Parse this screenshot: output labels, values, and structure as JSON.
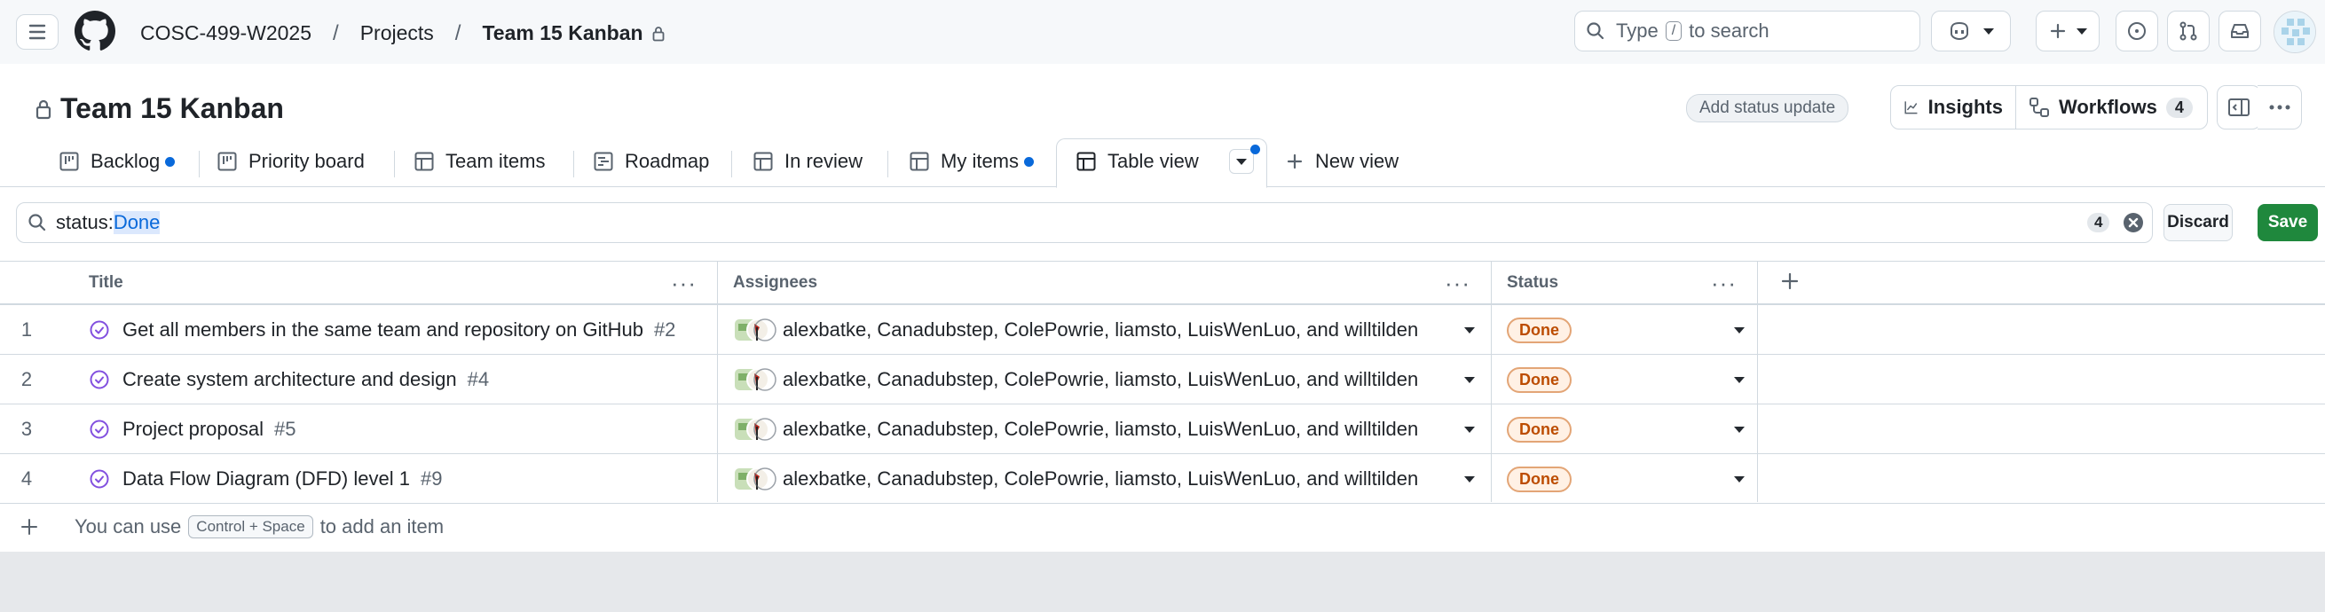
{
  "header": {
    "breadcrumb": [
      "COSC-499-W2025",
      "Projects",
      "Team 15 Kanban"
    ],
    "search_prefix": "Type",
    "search_kbd": "/",
    "search_suffix": "to search"
  },
  "project": {
    "title": "Team 15 Kanban",
    "add_status_update": "Add status update",
    "insights": "Insights",
    "workflows": "Workflows",
    "workflows_count": "4"
  },
  "tabs": [
    {
      "label": "Backlog",
      "dot": true
    },
    {
      "label": "Priority board",
      "dot": false
    },
    {
      "label": "Team items",
      "dot": false
    },
    {
      "label": "Roadmap",
      "dot": false
    },
    {
      "label": "In review",
      "dot": false
    },
    {
      "label": "My items",
      "dot": true
    },
    {
      "label": "Table view",
      "dot": true,
      "active": true
    }
  ],
  "new_view": "New view",
  "filter": {
    "key": "status:",
    "value": "Done",
    "count": "4",
    "discard": "Discard",
    "save": "Save"
  },
  "columns": {
    "title": "Title",
    "assignees": "Assignees",
    "status": "Status"
  },
  "rows": [
    {
      "num": "1",
      "title": "Get all members in the same team and repository on GitHub",
      "issue": "#2",
      "assignees": "alexbatke, Canadubstep, ColePowrie, liamsto, LuisWenLuo, and willtilden",
      "status": "Done"
    },
    {
      "num": "2",
      "title": "Create system architecture and design",
      "issue": "#4",
      "assignees": "alexbatke, Canadubstep, ColePowrie, liamsto, LuisWenLuo, and willtilden",
      "status": "Done"
    },
    {
      "num": "3",
      "title": "Project proposal",
      "issue": "#5",
      "assignees": "alexbatke, Canadubstep, ColePowrie, liamsto, LuisWenLuo, and willtilden",
      "status": "Done"
    },
    {
      "num": "4",
      "title": "Data Flow Diagram (DFD) level 1",
      "issue": "#9",
      "assignees": "alexbatke, Canadubstep, ColePowrie, liamsto, LuisWenLuo, and willtilden",
      "status": "Done"
    }
  ],
  "add_item": {
    "prefix": "You can use",
    "kbd": "Control + Space",
    "suffix": "to add an item"
  },
  "colors": {
    "accent": "#0969da",
    "save_green": "#1f883d",
    "done_orange": "#bc4c00",
    "issue_closed_purple": "#8250df"
  }
}
